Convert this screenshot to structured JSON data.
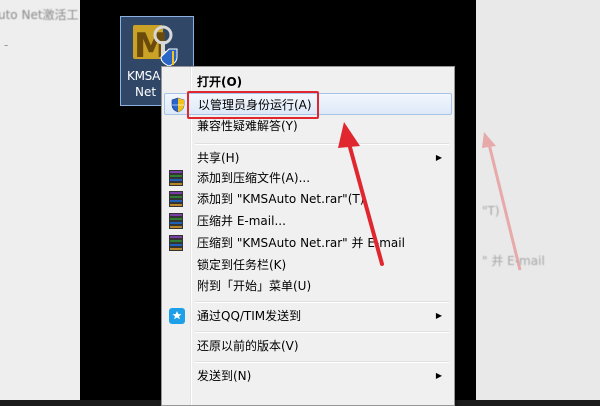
{
  "background_page": {
    "title_fragment": "uto Net激活工",
    "dash": "-",
    "right_ghost": [
      {
        "text": "\"T)"
      },
      {
        "text": "\" 并 E-mail"
      }
    ]
  },
  "desktop_icon": {
    "label_line1": "KMSAu",
    "label_line2": "Net",
    "icon": "kmsauto-keys-icon"
  },
  "context_menu": {
    "items": [
      {
        "label": "打开(O)",
        "bold": true
      },
      {
        "label": "以管理员身份运行(A)",
        "icon": "uac-shield-icon",
        "highlighted": true
      },
      {
        "label": "兼容性疑难解答(Y)"
      },
      {
        "label": "共享(H)",
        "submenu": true
      },
      {
        "label": "添加到压缩文件(A)...",
        "icon": "winrar-icon"
      },
      {
        "label": "添加到 \"KMSAuto Net.rar\"(T)",
        "icon": "winrar-icon"
      },
      {
        "label": "压缩并 E-mail...",
        "icon": "winrar-icon"
      },
      {
        "label": "压缩到 \"KMSAuto Net.rar\" 并 E-mail",
        "icon": "winrar-icon"
      },
      {
        "label": "锁定到任务栏(K)"
      },
      {
        "label": "附到「开始」菜单(U)"
      },
      {
        "label": "通过QQ/TIM发送到",
        "icon": "qq-icon",
        "submenu": true
      },
      {
        "label": "还原以前的版本(V)"
      },
      {
        "label": "发送到(N)",
        "submenu": true
      }
    ],
    "submenu_arrow": "▶"
  },
  "colors": {
    "annotation_red": "#e0272f",
    "menu_bg": "#f0f0f0",
    "highlight_border": "#a8c3e8"
  }
}
